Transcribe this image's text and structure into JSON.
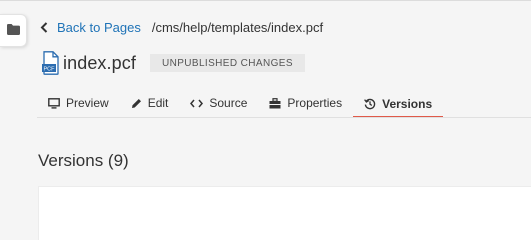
{
  "breadcrumb": {
    "back_label": "Back to Pages",
    "path": "/cms/help/templates/index.pcf"
  },
  "file": {
    "name": "index.pcf",
    "icon_badge": "PCF",
    "status_badge": "UNPUBLISHED CHANGES"
  },
  "tabs": [
    {
      "label": "Preview",
      "icon": "monitor-icon"
    },
    {
      "label": "Edit",
      "icon": "pencil-icon"
    },
    {
      "label": "Source",
      "icon": "code-icon"
    },
    {
      "label": "Properties",
      "icon": "toolbox-icon"
    },
    {
      "label": "Versions",
      "icon": "history-icon",
      "active": true
    }
  ],
  "versions": {
    "title": "Versions (9)"
  },
  "colors": {
    "link": "#1f73b7",
    "active_tab_underline": "#e05a49",
    "file_icon_blue": "#2b6cb0"
  }
}
